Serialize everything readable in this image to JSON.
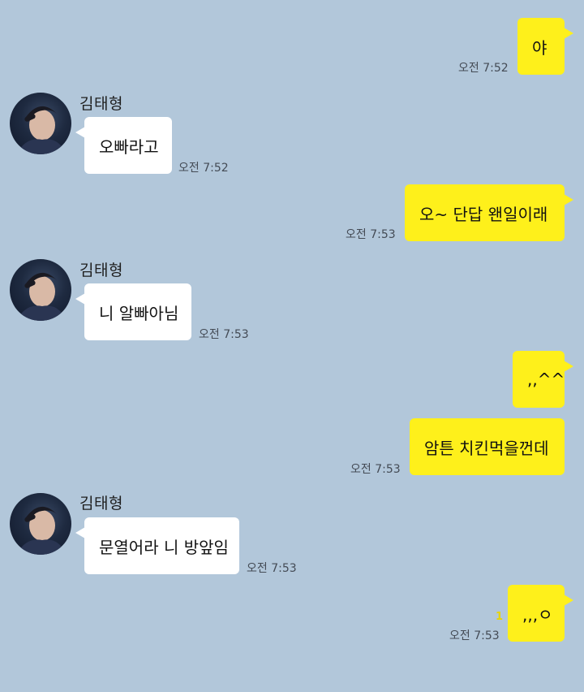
{
  "contact": {
    "name": "김태형"
  },
  "messages": [
    {
      "from": "me",
      "text": "야",
      "time": "오전 7:52"
    },
    {
      "from": "them",
      "sender": "김태형",
      "text": "오빠라고",
      "time": "오전 7:52"
    },
    {
      "from": "me",
      "text": "오~ 단답 왠일이래",
      "time": "오전 7:53"
    },
    {
      "from": "them",
      "sender": "김태형",
      "text": "니 알빠아님",
      "time": "오전 7:53"
    },
    {
      "from": "me",
      "text": ",,^^",
      "time": ""
    },
    {
      "from": "me",
      "text": "암튼 치킨먹을껀데",
      "time": "오전 7:53"
    },
    {
      "from": "them",
      "sender": "김태형",
      "text": "문열어라 니 방앞임",
      "time": "오전 7:53"
    },
    {
      "from": "me",
      "text": ",,,ㅇ",
      "time": "오전 7:53",
      "unread": "1"
    }
  ],
  "colors": {
    "background": "#b2c7da",
    "my_bubble": "#fef01b",
    "their_bubble": "#ffffff"
  }
}
